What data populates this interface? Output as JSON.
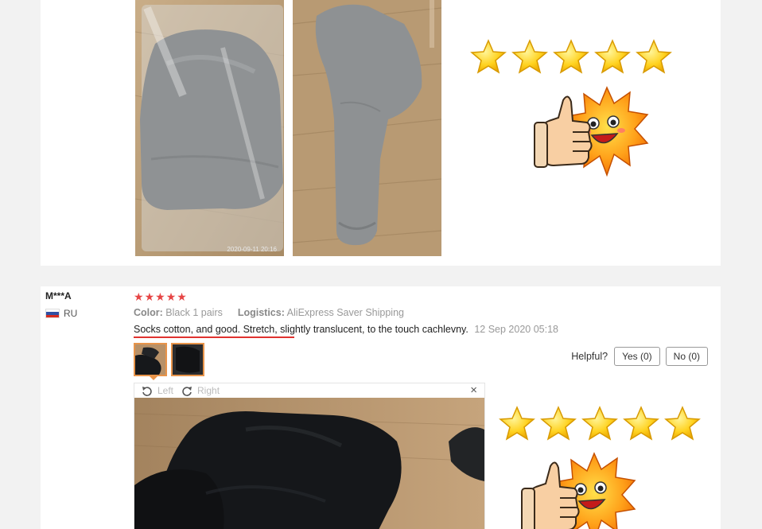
{
  "review": {
    "user": "M***A",
    "country_code": "RU",
    "rating": 5,
    "props": {
      "color_label": "Color:",
      "color_value": "Black 1 pairs",
      "logistics_label": "Logistics:",
      "logistics_value": "AliExpress Saver Shipping"
    },
    "text": "Socks cotton, and good. Stretch, slightly translucent, to the touch cachlevny.",
    "date": "12 Sep 2020 05:18",
    "helpful_label": "Helpful?",
    "yes_label": "Yes (0)",
    "no_label": "No (0)",
    "viewer": {
      "rotate_left": "Left",
      "rotate_right": "Right",
      "close": "×"
    }
  },
  "photo_timestamp": "2020-09-11 20:16",
  "colors": {
    "page_bg": "#f2f2f2",
    "card_bg": "#ffffff",
    "star_red": "#e64545",
    "underline_red": "#e0322f",
    "thumb_border": "#e8944a",
    "sock_gray": "#8f9294",
    "sock_black": "#15171a",
    "floor_wood": "#b5956e"
  },
  "icons": [
    "star-icon",
    "rotate-left-icon",
    "rotate-right-icon",
    "close-icon",
    "thumbs-up-sun-sticker"
  ]
}
